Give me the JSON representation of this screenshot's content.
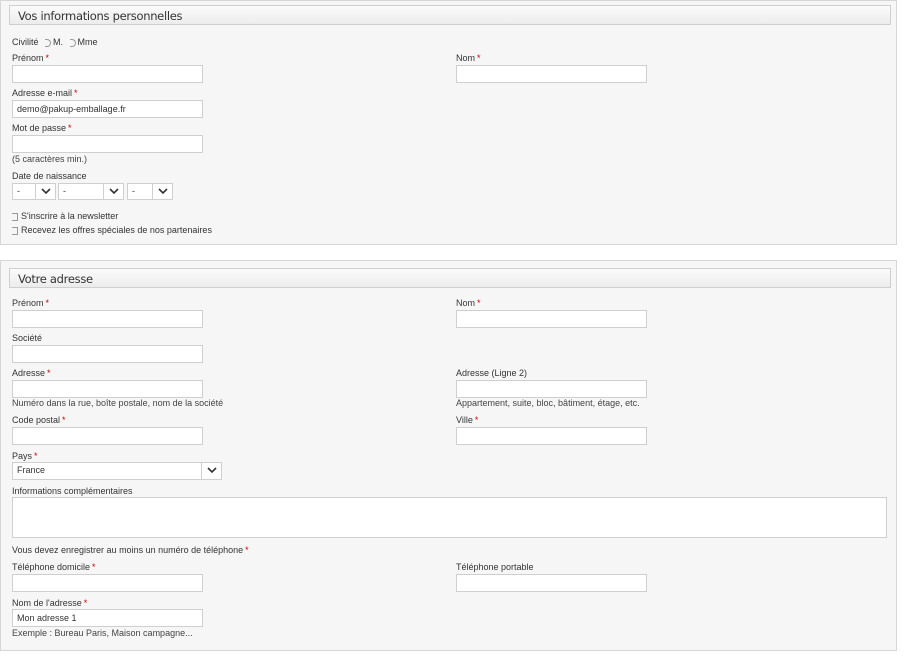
{
  "personal": {
    "title": "Vos informations personnelles",
    "civility_label": "Civilité",
    "civility_options": [
      "M.",
      "Mme"
    ],
    "firstname_label": "Prénom",
    "lastname_label": "Nom",
    "email_label": "Adresse e-mail",
    "email_value": "demo@pakup-emballage.fr",
    "password_label": "Mot de passe",
    "password_hint": "(5 caractères min.)",
    "birthdate_label": "Date de naissance",
    "birth_day": "-",
    "birth_month": "-",
    "birth_year": "-",
    "newsletter_label": "S'inscrire à la newsletter",
    "partners_label": "Recevez les offres spéciales de nos partenaires",
    "required_mark": "*"
  },
  "address": {
    "title": "Votre adresse",
    "firstname_label": "Prénom",
    "lastname_label": "Nom",
    "company_label": "Société",
    "address1_label": "Adresse",
    "address1_hint": "Numéro dans la rue, boîte postale, nom de la société",
    "address2_label": "Adresse (Ligne 2)",
    "address2_hint": "Appartement, suite, bloc, bâtiment, étage, etc.",
    "postcode_label": "Code postal",
    "city_label": "Ville",
    "country_label": "Pays",
    "country_value": "France",
    "other_label": "Informations complémentaires",
    "phone_notice": "Vous devez enregistrer au moins un numéro de téléphone",
    "phone_label": "Téléphone domicile",
    "mobile_label": "Téléphone portable",
    "alias_label": "Nom de l'adresse",
    "alias_value": "Mon adresse 1",
    "alias_hint": "Exemple : Bureau Paris, Maison campagne...",
    "required_mark": "*"
  },
  "colors": {
    "panel_bg": "#f6f6f6",
    "border": "#cfcfcf",
    "required": "#cc0000"
  }
}
